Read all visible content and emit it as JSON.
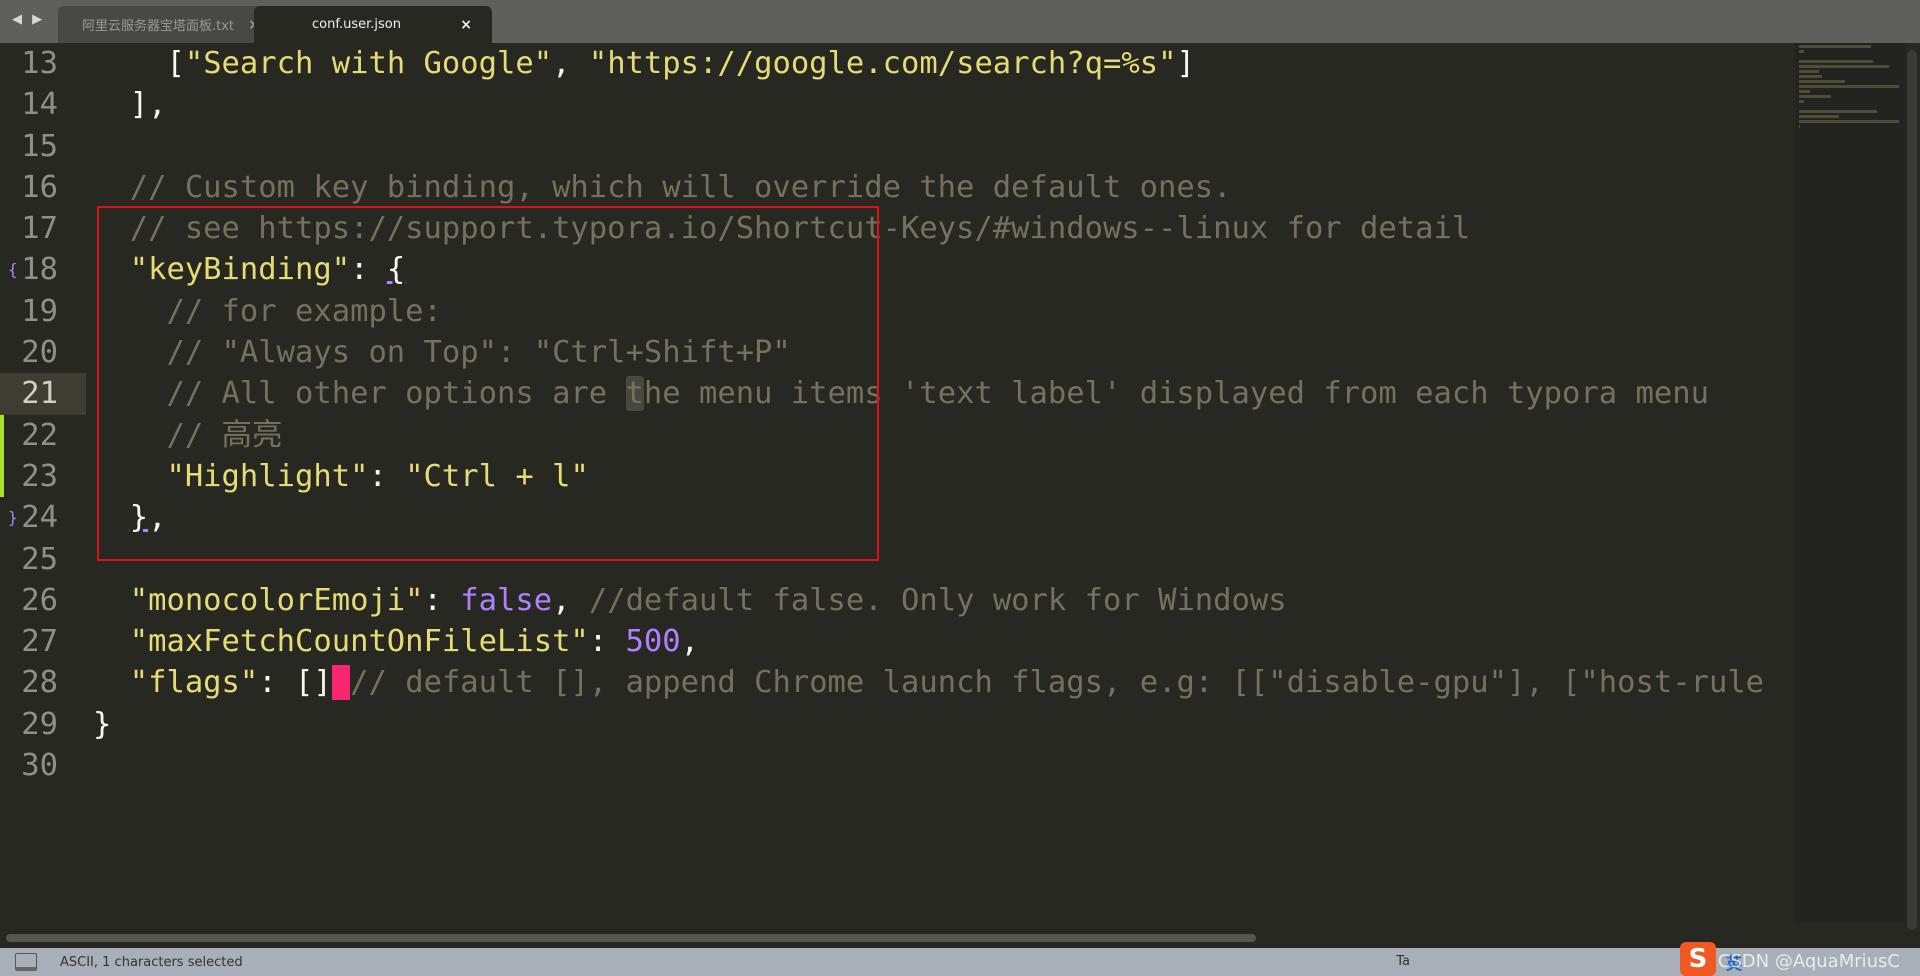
{
  "tabs": [
    {
      "label": "阿里云服务器宝塔面板.txt",
      "close": "×",
      "active": false
    },
    {
      "label": "conf.user.json",
      "close": "×",
      "active": true
    }
  ],
  "nav": "◀ ▶",
  "colors": {
    "string": "#e6db74",
    "comment": "#75715e",
    "punct": "#f8f8f2",
    "constant": "#ae81ff",
    "cursor": "#f92672",
    "highlight_box": "#e0101a"
  },
  "editor": {
    "current_line": 21,
    "modified_lines": [
      22,
      23
    ],
    "fold_markers": {
      "18": "{",
      "24": "}"
    },
    "lines": [
      {
        "n": "13",
        "tokens": [
          [
            "    ",
            "p"
          ],
          [
            "[",
            "p"
          ],
          [
            "\"Search with Google\"",
            "s"
          ],
          [
            ", ",
            "p"
          ],
          [
            "\"https://google.com/search?q=%s\"",
            "s"
          ],
          [
            "]",
            "p"
          ]
        ]
      },
      {
        "n": "14",
        "tokens": [
          [
            "  ],",
            "p"
          ]
        ]
      },
      {
        "n": "15",
        "tokens": []
      },
      {
        "n": "16",
        "tokens": [
          [
            "  ",
            "p"
          ],
          [
            "// Custom key binding, which will override the default ones.",
            "c"
          ]
        ]
      },
      {
        "n": "17",
        "tokens": [
          [
            "  ",
            "p"
          ],
          [
            "// see https://support.typora.io/Shortcut-Keys/#windows--linux for detail",
            "c"
          ]
        ]
      },
      {
        "n": "18",
        "tokens": [
          [
            "  ",
            "p"
          ],
          [
            "\"keyBinding\"",
            "s"
          ],
          [
            ": ",
            "p"
          ],
          [
            "{",
            "pu"
          ]
        ]
      },
      {
        "n": "19",
        "tokens": [
          [
            "    ",
            "p"
          ],
          [
            "// for example:",
            "c"
          ]
        ]
      },
      {
        "n": "20",
        "tokens": [
          [
            "    ",
            "p"
          ],
          [
            "// \"Always on Top\": \"Ctrl+Shift+P\"",
            "c"
          ]
        ]
      },
      {
        "n": "21",
        "tokens": [
          [
            "    ",
            "p"
          ],
          [
            "// All other options are ",
            "c"
          ],
          [
            "t",
            "sel"
          ],
          [
            "he menu items 'text label' displayed from each typora menu",
            "c"
          ]
        ]
      },
      {
        "n": "22",
        "tokens": [
          [
            "    ",
            "p"
          ],
          [
            "// 高亮",
            "c"
          ]
        ]
      },
      {
        "n": "23",
        "tokens": [
          [
            "    ",
            "p"
          ],
          [
            "\"Highlight\"",
            "s"
          ],
          [
            ": ",
            "p"
          ],
          [
            "\"Ctrl + l\"",
            "s"
          ]
        ]
      },
      {
        "n": "24",
        "tokens": [
          [
            "  ",
            "p"
          ],
          [
            "}",
            "pu"
          ],
          [
            ",",
            "p"
          ]
        ]
      },
      {
        "n": "25",
        "tokens": []
      },
      {
        "n": "26",
        "tokens": [
          [
            "  ",
            "p"
          ],
          [
            "\"monocolorEmoji\"",
            "s"
          ],
          [
            ": ",
            "p"
          ],
          [
            "false",
            "n"
          ],
          [
            ", ",
            "p"
          ],
          [
            "//default false. Only work for Windows",
            "c"
          ]
        ]
      },
      {
        "n": "27",
        "tokens": [
          [
            "  ",
            "p"
          ],
          [
            "\"maxFetchCountOnFileList\"",
            "s"
          ],
          [
            ": ",
            "p"
          ],
          [
            "500",
            "n"
          ],
          [
            ",",
            "p"
          ]
        ]
      },
      {
        "n": "28",
        "tokens": [
          [
            "  ",
            "p"
          ],
          [
            "\"flags\"",
            "s"
          ],
          [
            ": ",
            "p"
          ],
          [
            "[]",
            "p"
          ],
          [
            " ",
            "cur"
          ],
          [
            "// default [], append Chrome launch flags, e.g: [[\"disable-gpu\"], [\"host-rule",
            "c"
          ]
        ]
      },
      {
        "n": "29",
        "tokens": [
          [
            "}",
            "p"
          ]
        ]
      },
      {
        "n": "30",
        "tokens": []
      }
    ]
  },
  "status": {
    "text": "ASCII, 1 characters selected",
    "tab_size": "Ta"
  },
  "ime": {
    "logo": "S",
    "lang": "英",
    "watermark": "CSDN @AquaMriusC"
  }
}
